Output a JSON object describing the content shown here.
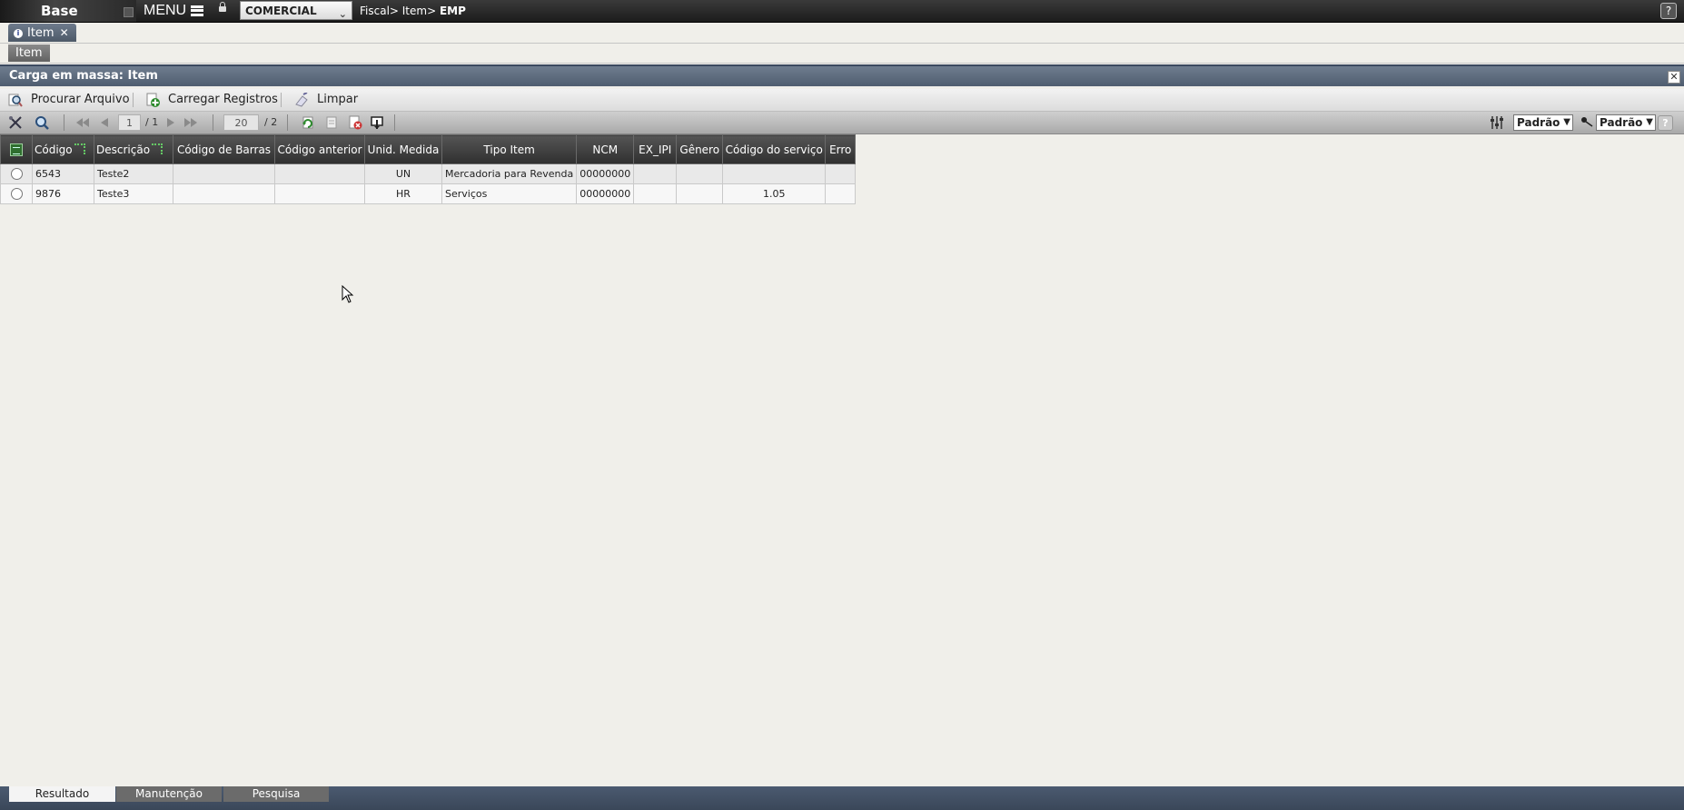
{
  "topbar": {
    "logo": "Base",
    "menu_label": "MENU",
    "company": "COMERCIAL",
    "breadcrumb": "Fiscal> Item>",
    "breadcrumb_bold": "EMP",
    "help": "?"
  },
  "tabs": {
    "open_tab": "Item",
    "sub_tab": "Item"
  },
  "panel": {
    "title": "Carga em massa: Item"
  },
  "actions": {
    "browse": "Procurar Arquivo",
    "load": "Carregar Registros",
    "clear": "Limpar"
  },
  "pager": {
    "page": "1",
    "page_total": "/ 1",
    "page_size": "20",
    "records_total": "/ 2",
    "view_select": "Padrão",
    "filter_select": "Padrão"
  },
  "grid": {
    "columns": [
      "Código",
      "Descrição",
      "Código de Barras",
      "Código anterior",
      "Unid. Medida",
      "Tipo Item",
      "NCM",
      "EX_IPI",
      "Gênero",
      "Código do serviço",
      "Erro"
    ],
    "rows": [
      {
        "codigo": "6543",
        "descricao": "Teste2",
        "barras": "",
        "anterior": "",
        "unid": "UN",
        "tipo": "Mercadoria para Revenda",
        "ncm": "00000000",
        "ex_ipi": "",
        "genero": "",
        "servico": "",
        "erro": ""
      },
      {
        "codigo": "9876",
        "descricao": "Teste3",
        "barras": "",
        "anterior": "",
        "unid": "HR",
        "tipo": "Serviços",
        "ncm": "00000000",
        "ex_ipi": "",
        "genero": "",
        "servico": "1.05",
        "erro": ""
      }
    ]
  },
  "bottom_tabs": [
    "Resultado",
    "Manutenção",
    "Pesquisa"
  ],
  "colors": {
    "header_bar": "#4f5d6f",
    "grid_header": "#2f2f2f",
    "page_bg": "#f0efea"
  }
}
